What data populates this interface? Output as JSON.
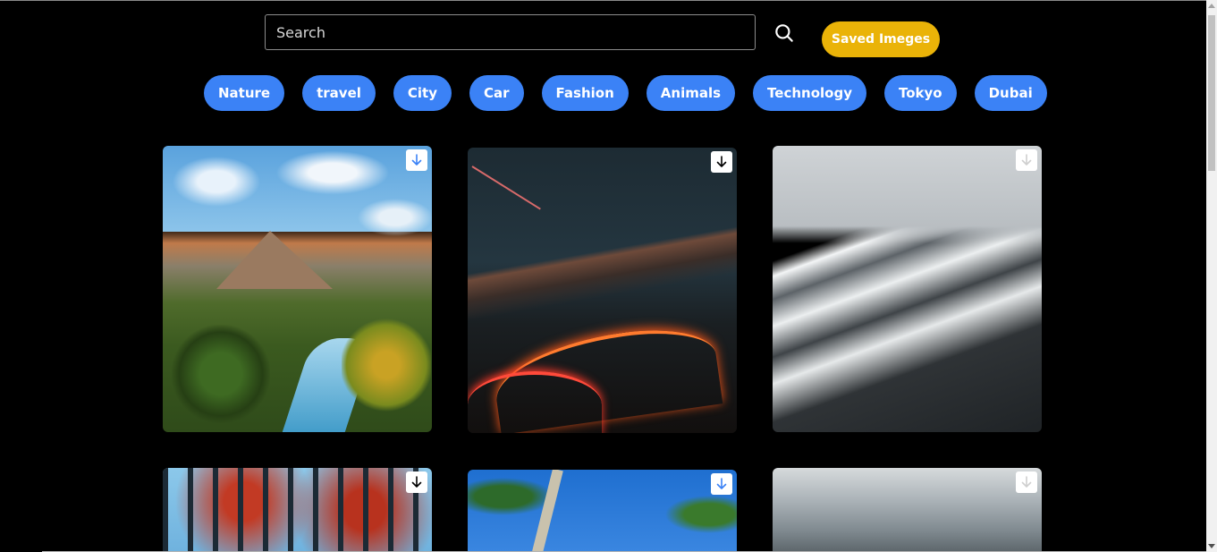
{
  "search": {
    "placeholder": "Search",
    "value": "",
    "button_icon": "search-icon"
  },
  "header": {
    "saved_label": "Saved Imeges"
  },
  "categories": [
    "Nature",
    "travel",
    "City",
    "Car",
    "Fashion",
    "Animals",
    "Technology",
    "Tokyo",
    "Dubai"
  ],
  "images": [
    {
      "subject": "canyon river",
      "download_icon": "download-icon"
    },
    {
      "subject": "night highway",
      "download_icon": "download-icon"
    },
    {
      "subject": "snowy mountains",
      "download_icon": "download-icon"
    },
    {
      "subject": "autumn forest",
      "download_icon": "download-icon"
    },
    {
      "subject": "palm trees",
      "download_icon": "download-icon"
    },
    {
      "subject": "cloudy sky",
      "download_icon": "download-icon"
    }
  ],
  "colors": {
    "background": "#000000",
    "chip": "#3b82f6",
    "saved_button": "#eab308",
    "text": "#ffffff"
  }
}
